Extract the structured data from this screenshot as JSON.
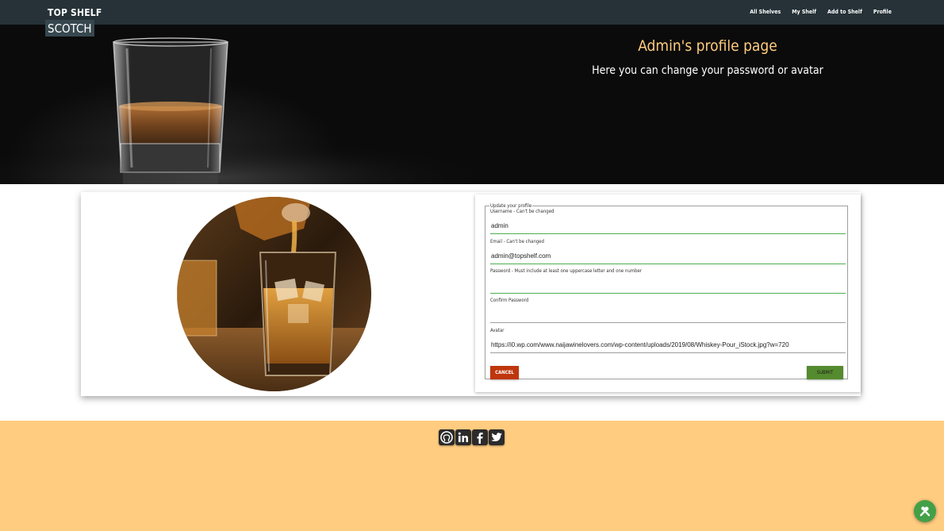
{
  "brand": {
    "line1": "TOP SHELF",
    "line2": "SCOTCH"
  },
  "nav": [
    {
      "label": "All Shelves"
    },
    {
      "label": "My Shelf"
    },
    {
      "label": "Add to Shelf"
    },
    {
      "label": "Profile"
    }
  ],
  "hero": {
    "title": "Admin's profile page",
    "subtitle": "Here you can change your password or avatar"
  },
  "form": {
    "legend": "Update your profile",
    "username": {
      "label": "Username - Can't be changed",
      "value": "admin"
    },
    "email": {
      "label": "Email - Can't be changed",
      "value": "admin@topshelf.com"
    },
    "password": {
      "label": "Password - Must include at least one uppercase letter and one number",
      "value": ""
    },
    "confirm": {
      "label": "Confirm Password",
      "value": ""
    },
    "avatar": {
      "label": "Avatar",
      "value": "https://i0.wp.com/www.naijawinelovers.com/wp-content/uploads/2019/08/Whiskey-Pour_iStock.jpg?w=720"
    },
    "cancel_label": "CANCEL",
    "submit_label": "SUBMIT"
  },
  "footer": {
    "icons": [
      "github-icon",
      "linkedin-icon",
      "facebook-icon",
      "twitter-icon"
    ]
  },
  "colors": {
    "navbar": "#263238",
    "accent": "#ffcc80",
    "cancel": "#bf360c",
    "submit": "#558b2f",
    "fab": "#43a047"
  }
}
